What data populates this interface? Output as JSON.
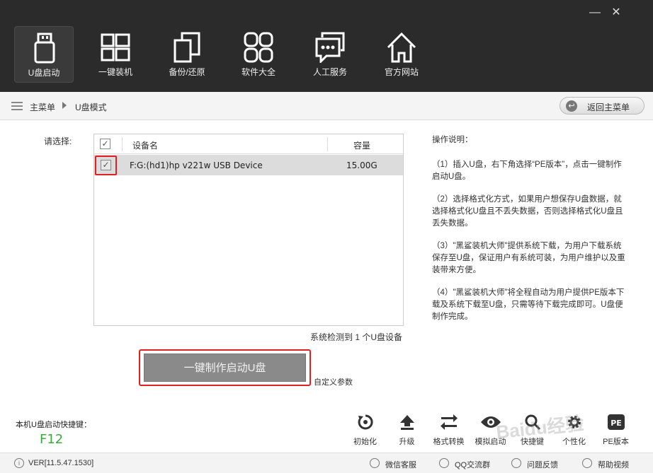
{
  "window": {
    "minimize_label": "—",
    "close_label": "✕"
  },
  "nav": {
    "items": [
      {
        "label": "U盘启动",
        "icon": "usb-drive-icon"
      },
      {
        "label": "一键装机",
        "icon": "windows-icon"
      },
      {
        "label": "备份/还原",
        "icon": "backup-icon"
      },
      {
        "label": "软件大全",
        "icon": "apps-grid-icon"
      },
      {
        "label": "人工服务",
        "icon": "chat-icon"
      },
      {
        "label": "官方网站",
        "icon": "home-icon"
      }
    ]
  },
  "breadcrumb": {
    "home": "主菜单",
    "current": "U盘模式"
  },
  "back_button": {
    "label": "返回主菜单",
    "icon": "back-arrow-icon"
  },
  "select_label": "请选择:",
  "device_table": {
    "headers": {
      "check": "✓",
      "name": "设备名",
      "capacity": "容量"
    },
    "rows": [
      {
        "checked": "✓",
        "name": "F:G:(hd1)hp v221w USB Device",
        "capacity": "15.00G"
      }
    ]
  },
  "detect_text": "系统检测到 1 个U盘设备",
  "make_button": "一键制作启动U盘",
  "custom_params": "自定义参数",
  "instructions": {
    "title": "操作说明：",
    "steps": [
      "（1）插入U盘，右下角选择“PE版本”，点击一键制作启动U盘。",
      "（2）选择格式化方式，如果用户想保存U盘数据，就选择格式化U盘且不丢失数据，否则选择格式化U盘且丢失数据。",
      "（3）\"黑鲨装机大师\"提供系统下载，为用户下载系统保存至U盘，保证用户有系统可装，为用户维护以及重装带来方便。",
      "（4）\"黑鲨装机大师\"将全程自动为用户提供PE版本下载及系统下载至U盘，只需等待下载完成即可。U盘便制作完成。"
    ]
  },
  "hotkey": {
    "label": "本机U盘启动快捷键：",
    "value": "F12"
  },
  "tools": [
    {
      "label": "初始化",
      "icon": "reset-icon"
    },
    {
      "label": "升级",
      "icon": "upgrade-icon"
    },
    {
      "label": "格式转换",
      "icon": "convert-icon"
    },
    {
      "label": "模拟启动",
      "icon": "eye-icon"
    },
    {
      "label": "快捷键",
      "icon": "search-icon"
    },
    {
      "label": "个性化",
      "icon": "gear-icon"
    },
    {
      "label": "PE版本",
      "icon": "pe-icon"
    }
  ],
  "statusbar": {
    "version": "VER[11.5.47.1530]",
    "items": [
      {
        "label": "微信客服",
        "icon": "wechat-icon"
      },
      {
        "label": "QQ交流群",
        "icon": "qq-icon"
      },
      {
        "label": "问题反馈",
        "icon": "feedback-icon"
      },
      {
        "label": "帮助视频",
        "icon": "help-video-icon"
      }
    ]
  },
  "watermark": "Baidu经验",
  "colors": {
    "topbar": "#2b2b2b",
    "highlight": "#e02020",
    "hotkey": "#3aaa3a",
    "button": "#8a8a8a"
  }
}
